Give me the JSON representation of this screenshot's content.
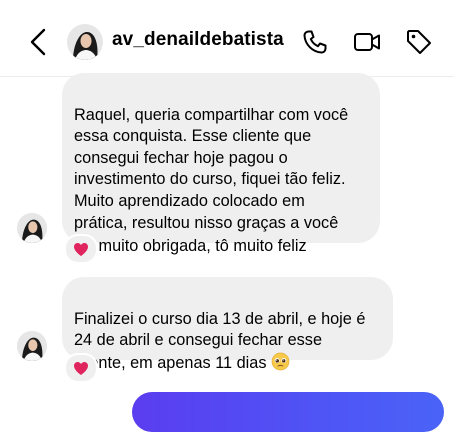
{
  "header": {
    "username": "av_denaildebatista"
  },
  "messages": [
    {
      "from": "av_denaildebatista",
      "text_before_emoji": "Raquel, queria compartilhar com você\nessa conquista. Esse cliente que\nconsegui fechar hoje pagou o\ninvestimento do curso, fiquei tão feliz.\nMuito aprendizado colocado em\nprática, resultou nisso graças a você\n",
      "emoji": "folded-hands",
      "text_after_emoji": " muito obrigada, tô muito feliz",
      "reaction": "red-heart"
    },
    {
      "from": "av_denaildebatista",
      "text_before_emoji": "Finalizei o curso dia 13 de abril, e hoje é\n24 de abril e consegui fechar esse\ncliente, em apenas 11 dias ",
      "emoji": "pleading-face",
      "reaction": "red-heart"
    }
  ],
  "colors": {
    "received_bubble": "#efefef",
    "sent_bubble_start": "#5a3df0",
    "sent_bubble_end": "#4a63f7",
    "heart": "#e0245e"
  }
}
